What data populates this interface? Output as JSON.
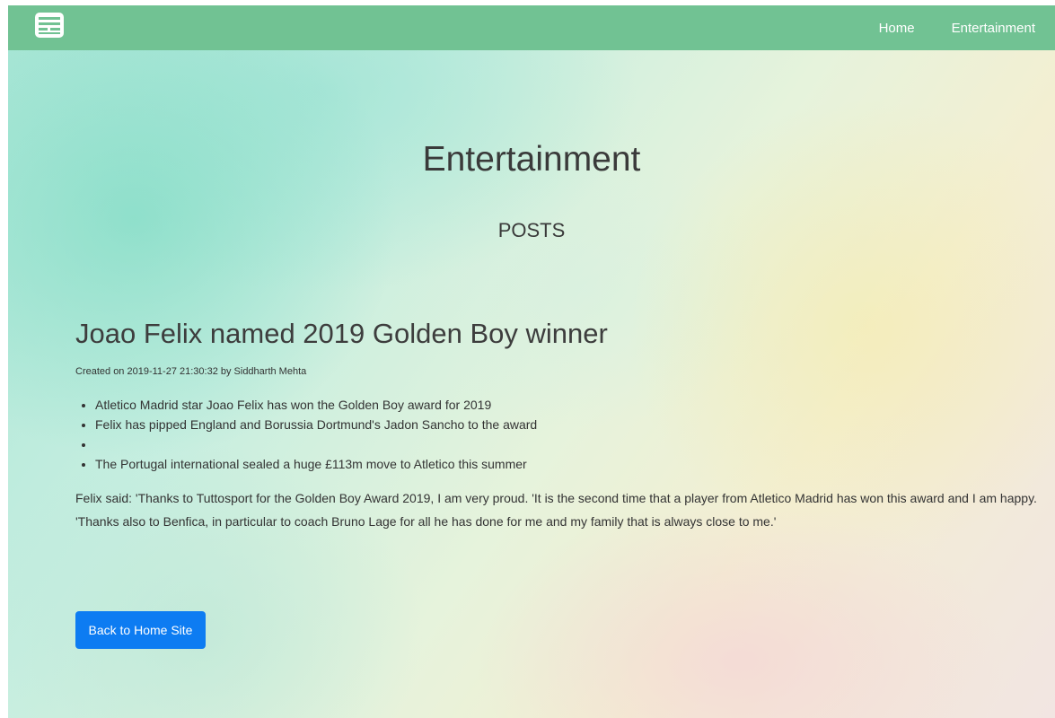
{
  "navbar": {
    "brand_icon": "newspaper-list-icon",
    "links": [
      "Home",
      "Entertainment"
    ]
  },
  "hero": {
    "title": "Entertainment",
    "subtitle": "POSTS"
  },
  "post": {
    "title": "Joao Felix named 2019 Golden Boy winner",
    "meta": "Created on 2019-11-27 21:30:32 by Siddharth Mehta",
    "bullets": [
      "Atletico Madrid star Joao Felix has won the Golden Boy award for 2019",
      "Felix has pipped England and Borussia Dortmund's Jadon Sancho to the award",
      "",
      "The Portugal international sealed a huge £113m move to Atletico this summer"
    ],
    "body": "Felix said: 'Thanks to Tuttosport for the Golden Boy Award 2019, I am very proud. 'It is the second time that a player from Atletico Madrid has won this award and I am happy. 'Thanks also to Benfica, in particular to coach Bruno Lage for all he has done for me and my family that is always close to me.'"
  },
  "back_button": {
    "label": "Back to Home Site"
  },
  "colors": {
    "navbar": "#71c293",
    "button": "#0d7cf2"
  }
}
